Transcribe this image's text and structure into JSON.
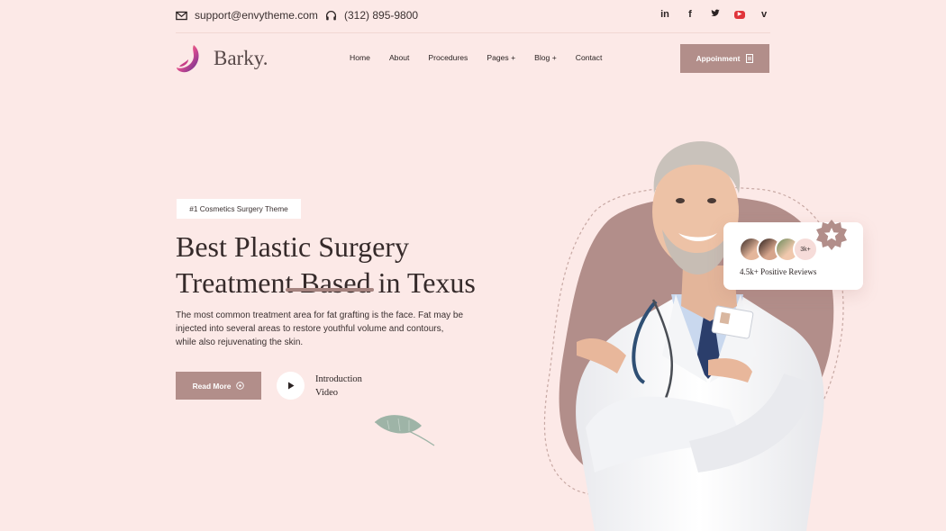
{
  "topbar": {
    "email": "support@envytheme.com",
    "phone": "(312) 895-9800",
    "social": [
      "in",
      "f",
      "t",
      "yt",
      "v"
    ]
  },
  "brand": {
    "name": "Barky."
  },
  "nav": {
    "items": [
      "Home",
      "About",
      "Procedures",
      "Pages +",
      "Blog +",
      "Contact"
    ]
  },
  "header": {
    "appointment_label": "Appoinment"
  },
  "hero": {
    "badge": "#1 Cosmetics Surgery Theme",
    "title_line1": "Best Plastic Surgery",
    "title_line2": "Treatment Based in Texus",
    "description": "The most common treatment area for fat grafting is the face. Fat may be injected into several areas to restore youthful volume and contours, while also rejuvenating the skin.",
    "read_more_label": "Read More",
    "video_label_1": "Introduction",
    "video_label_2": "Video"
  },
  "reviews": {
    "count_label": "3k+",
    "text": "4.5k+ Positive Reviews"
  },
  "colors": {
    "background": "#fce9e7",
    "accent": "#b28e8a",
    "text": "#2b2323"
  },
  "icons": [
    "mail-icon",
    "headset-icon",
    "linkedin-icon",
    "facebook-icon",
    "twitter-icon",
    "youtube-icon",
    "vimeo-icon",
    "document-icon",
    "arrow-circle-icon",
    "play-icon",
    "star-icon",
    "leaf-icon"
  ]
}
